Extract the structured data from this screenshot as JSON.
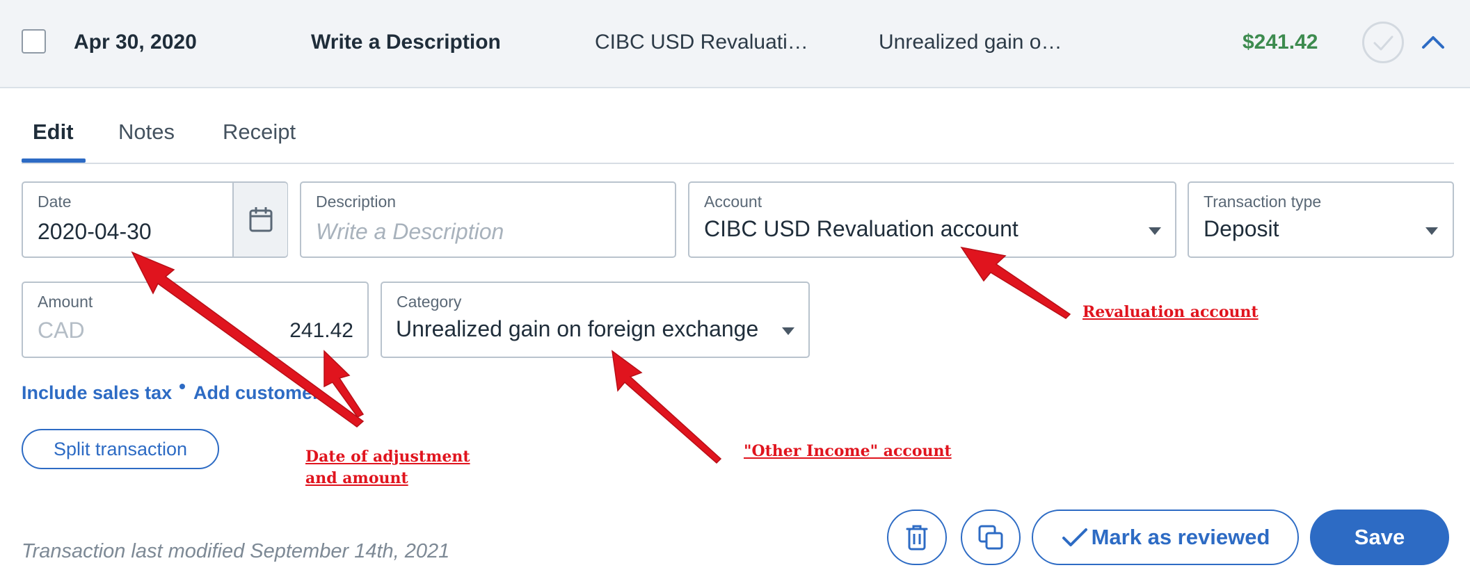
{
  "summary": {
    "date": "Apr 30, 2020",
    "description": "Write a Description",
    "account": "CIBC USD Revaluati…",
    "category": "Unrealized gain o…",
    "amount": "$241.42",
    "amount_color": "#3d8b4f"
  },
  "tabs": [
    {
      "label": "Edit",
      "active": true
    },
    {
      "label": "Notes",
      "active": false
    },
    {
      "label": "Receipt",
      "active": false
    }
  ],
  "form": {
    "date": {
      "label": "Date",
      "value": "2020-04-30",
      "icon": "calendar-icon"
    },
    "description": {
      "label": "Description",
      "placeholder": "Write a Description"
    },
    "account": {
      "label": "Account",
      "value": "CIBC USD Revaluation account"
    },
    "transaction_type": {
      "label": "Transaction type",
      "value": "Deposit"
    },
    "amount": {
      "label": "Amount",
      "currency": "CAD",
      "value": "241.42"
    },
    "category": {
      "label": "Category",
      "value": "Unrealized gain on foreign exchange"
    }
  },
  "links": {
    "sales_tax": "Include sales tax",
    "add_customer": "Add customer"
  },
  "buttons": {
    "split": "Split transaction",
    "delete_icon": "trash-icon",
    "copy_icon": "copy-icon",
    "mark_reviewed": "Mark as reviewed",
    "save": "Save"
  },
  "footer": {
    "modified": "Transaction last modified September 14th, 2021"
  },
  "annotations": {
    "revaluation": "Revaluation account",
    "date_amount_line1": "Date of adjustment",
    "date_amount_line2": "and amount",
    "other_income": "\"Other Income\" account",
    "color": "#e0141e"
  },
  "colors": {
    "accent": "#2d6bc4",
    "summary_bg": "#f2f4f7"
  }
}
